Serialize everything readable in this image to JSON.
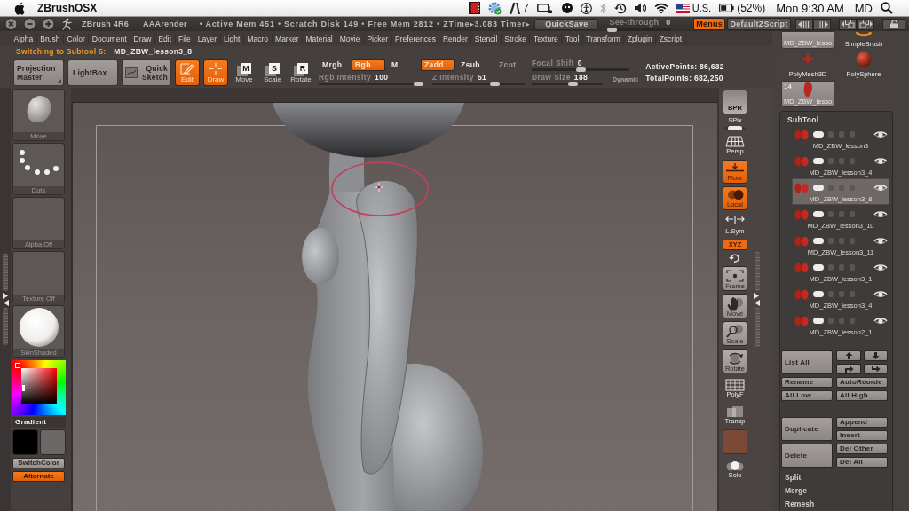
{
  "menubar": {
    "app_name": "ZBrushOSX",
    "badge_count": "7",
    "input_source": "U.S.",
    "battery": "(52%)",
    "clock": "Mon 9:30 AM",
    "user": "MD"
  },
  "title_bar": {
    "title": "ZBrush 4R6",
    "render_mode": "AAArender",
    "stats": "• Active Mem 451 • Scratch Disk 149 • Free Mem 2812 • ZTime▸3.083 Timer▸",
    "quicksave": "QuickSave",
    "see_through": {
      "label": "See-through",
      "value": "0",
      "level": 0
    },
    "menus_toggle": {
      "label": "Menus",
      "on": true
    },
    "script": "DefaultZScript"
  },
  "menus": [
    "Alpha",
    "Brush",
    "Color",
    "Document",
    "Draw",
    "Edit",
    "File",
    "Layer",
    "Light",
    "Macro",
    "Marker",
    "Material",
    "Movie",
    "Picker",
    "Preferences",
    "Render",
    "Stencil",
    "Stroke",
    "Texture",
    "Tool",
    "Transform",
    "Zplugin",
    "Zscript"
  ],
  "notice": {
    "message": "Switching to Subtool 5:",
    "subtool": "MD_ZBW_lesson3_8"
  },
  "toolbar": {
    "projection_master": "Projection Master",
    "lightbox": "LightBox",
    "quick_sketch": "Quick Sketch",
    "modes": [
      {
        "label": "Edit",
        "on": true
      },
      {
        "label": "Draw",
        "on": true
      },
      {
        "label": "Move",
        "key": "M",
        "on": false
      },
      {
        "label": "Scale",
        "key": "S",
        "on": false
      },
      {
        "label": "Rotate",
        "key": "R",
        "on": false
      }
    ],
    "rgb_modes": [
      {
        "label": "Mrgb",
        "on": false
      },
      {
        "label": "Rgb",
        "on": true
      },
      {
        "label": "M",
        "on": false
      }
    ],
    "z_modes": [
      {
        "label": "Zadd",
        "on": true,
        "disabled": false
      },
      {
        "label": "Zsub",
        "on": false,
        "disabled": false
      },
      {
        "label": "Zcut",
        "on": false,
        "disabled": true
      }
    ],
    "rgb_intensity": {
      "label": "Rgb Intensity",
      "value": "100",
      "level": 1
    },
    "z_intensity": {
      "label": "Z Intensity",
      "value": "51",
      "level": 0.7
    },
    "focal_shift": {
      "label": "Focal Shift",
      "value": "0",
      "level": 0.5
    },
    "draw_size": {
      "label": "Draw Size",
      "value": "188",
      "level": 0.6
    },
    "dynamic": "Dynamic",
    "active_points": "ActivePoints: 86,632",
    "total_points": "TotalPoints: 682,250"
  },
  "left_shelf": {
    "tiles": [
      {
        "kind": "brush",
        "label": "Move"
      },
      {
        "kind": "stroke",
        "label": "Dots"
      },
      {
        "kind": "alpha",
        "label": "Alpha Off"
      },
      {
        "kind": "texture",
        "label": "Texture Off"
      },
      {
        "kind": "material",
        "label": "SkinShaded"
      }
    ],
    "gradient": "Gradient",
    "swatches": [
      {
        "color": "#000000"
      },
      {
        "color": "#6b6767"
      }
    ],
    "switch_color": "SwitchColor",
    "alternate": {
      "label": "Alternate",
      "on": true
    }
  },
  "right_shelf": [
    {
      "kind": "tile",
      "label": "BPR"
    },
    {
      "kind": "slider",
      "label": "SPix",
      "level": 0.5
    },
    {
      "kind": "toggle",
      "label": "Persp",
      "on": false
    },
    {
      "kind": "toggle",
      "label": "Floor",
      "on": true
    },
    {
      "kind": "toggle",
      "label": "Local",
      "on": true
    },
    {
      "kind": "toggle",
      "label": "L.Sym",
      "on": false
    },
    {
      "kind": "chip",
      "label": "XYZ",
      "on": true
    },
    {
      "kind": "icon"
    },
    {
      "kind": "button",
      "label": "Frame"
    },
    {
      "kind": "button",
      "label": "Move"
    },
    {
      "kind": "button",
      "label": "Scale"
    },
    {
      "kind": "button",
      "label": "Rotate"
    },
    {
      "kind": "toggle",
      "label": "PolyF",
      "on": false
    },
    {
      "kind": "toggle",
      "label": "Transp",
      "on": false
    },
    {
      "kind": "swatch",
      "color": "#7b4a36"
    },
    {
      "kind": "toggle",
      "label": "Solo",
      "on": false
    }
  ],
  "tool_thumbnails": [
    {
      "kind": "mesh",
      "label": "MD_ZBW_lesso"
    },
    {
      "kind": "primitive",
      "label": "SimpleBrush"
    },
    {
      "kind": "primitive",
      "label": "PolyMesh3D"
    },
    {
      "kind": "primitive",
      "label": "PolySphere"
    },
    {
      "kind": "mesh",
      "label": "MD_ZBW_lesso",
      "count": "14"
    }
  ],
  "subtool": {
    "title": "SubTool",
    "items": [
      {
        "name": "MD_ZBW_lesson3",
        "selected": false,
        "visible": true
      },
      {
        "name": "MD_ZBW_lesson3_4",
        "selected": false,
        "visible": true
      },
      {
        "name": "MD_ZBW_lesson3_8",
        "selected": true,
        "visible": true
      },
      {
        "name": "MD_ZBW_lesson3_10",
        "selected": false,
        "visible": true
      },
      {
        "name": "MD_ZBW_lesson3_11",
        "selected": false,
        "visible": true
      },
      {
        "name": "MD_ZBW_lesson3_1",
        "selected": false,
        "visible": true
      },
      {
        "name": "MD_ZBW_lesson3_4",
        "selected": false,
        "visible": true
      },
      {
        "name": "MD_ZBW_lesson2_1",
        "selected": false,
        "visible": true
      }
    ],
    "list_all": "List All",
    "rename": "Rename",
    "auto_reorder": "AutoReorde",
    "all_low": "All Low",
    "all_high": "All High",
    "duplicate": "Duplicate",
    "append": "Append",
    "insert": "Insert",
    "delete": "Delete",
    "del_other": "Del Other",
    "del_all": "Del All",
    "sections": [
      "Split",
      "Merge",
      "Remesh"
    ]
  }
}
